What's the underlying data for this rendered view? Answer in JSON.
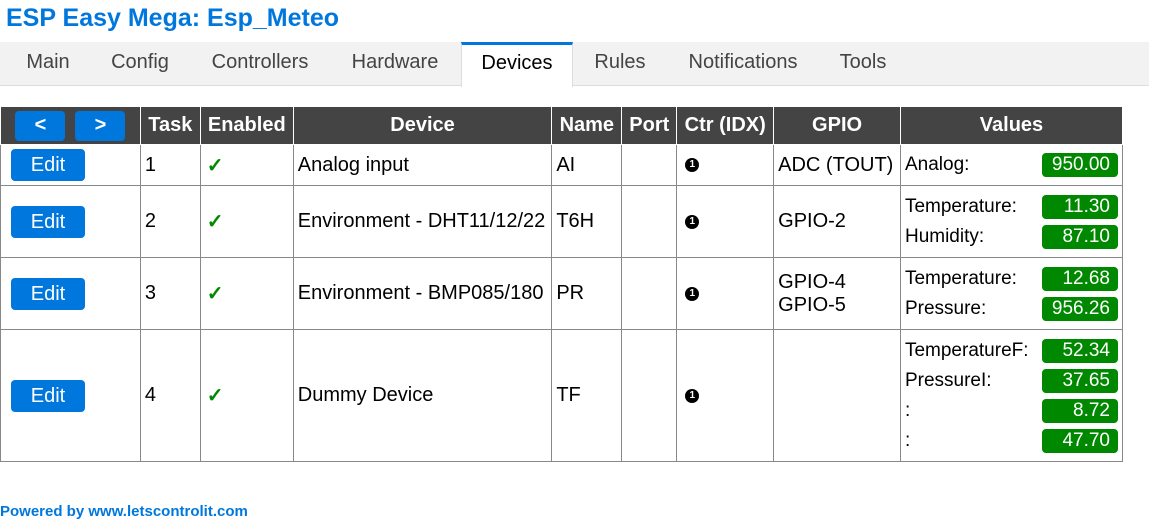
{
  "page": {
    "title": "ESP Easy Mega: Esp_Meteo"
  },
  "tabs": [
    "Main",
    "Config",
    "Controllers",
    "Hardware",
    "Devices",
    "Rules",
    "Notifications",
    "Tools"
  ],
  "active_tab": "Devices",
  "table": {
    "nav": {
      "prev": "<",
      "next": ">"
    },
    "headers": {
      "task": "Task",
      "enabled": "Enabled",
      "device": "Device",
      "name": "Name",
      "port": "Port",
      "ctr": "Ctr (IDX)",
      "gpio": "GPIO",
      "values": "Values"
    },
    "edit_label": "Edit",
    "check": "✓",
    "ctr_mark": "1",
    "rows": [
      {
        "task": "1",
        "device": "Analog input",
        "name": "AI",
        "port": "",
        "gpio": [
          "ADC (TOUT)"
        ],
        "values": [
          {
            "label": "Analog:",
            "value": "950.00"
          }
        ]
      },
      {
        "task": "2",
        "device": "Environment - DHT11/12/22",
        "name": "T6H",
        "port": "",
        "gpio": [
          "GPIO-2"
        ],
        "values": [
          {
            "label": "Temperature:",
            "value": "11.30"
          },
          {
            "label": "Humidity:",
            "value": "87.10"
          }
        ]
      },
      {
        "task": "3",
        "device": "Environment - BMP085/180",
        "name": "PR",
        "port": "",
        "gpio": [
          "GPIO-4",
          "GPIO-5"
        ],
        "values": [
          {
            "label": "Temperature:",
            "value": "12.68"
          },
          {
            "label": "Pressure:",
            "value": "956.26"
          }
        ]
      },
      {
        "task": "4",
        "device": "Dummy Device",
        "name": "TF",
        "port": "",
        "gpio": [],
        "values": [
          {
            "label": "TemperatureF:",
            "value": "52.34"
          },
          {
            "label": "PressureI:",
            "value": "37.65"
          },
          {
            "label": ":",
            "value": "8.72"
          },
          {
            "label": ":",
            "value": "47.70"
          }
        ]
      }
    ]
  },
  "footer": "Powered by www.letscontrolit.com"
}
